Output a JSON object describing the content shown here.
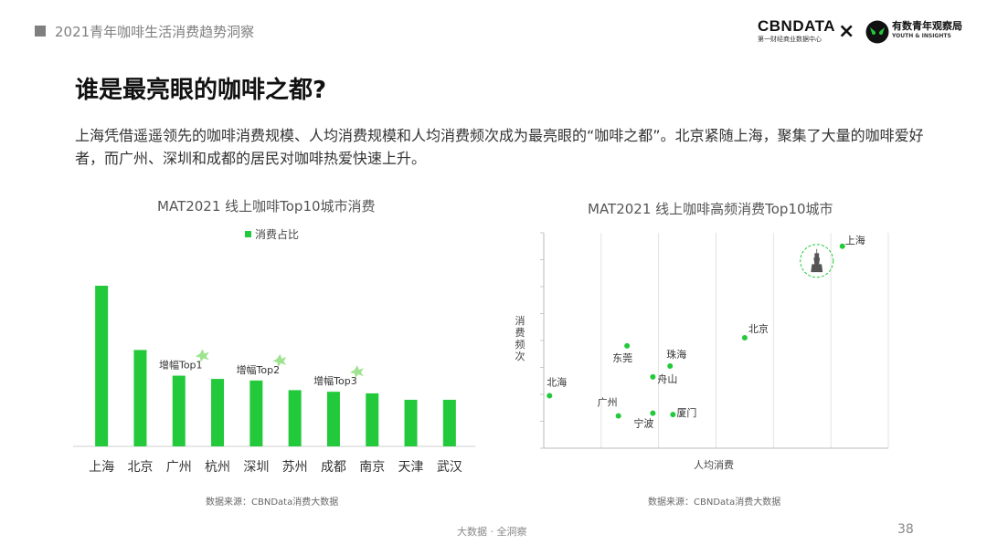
{
  "header": {
    "title": "2021青年咖啡生活消费趋势洞察"
  },
  "logos": {
    "cbn_name": "CBNDATA",
    "cbn_sub": "第一财经商业数据中心",
    "times": "×",
    "youth_name": "有数青年观察局",
    "youth_sub": "YOUTH & INSIGHTS"
  },
  "page": {
    "title": "谁是最亮眼的咖啡之都?",
    "intro": "上海凭借遥遥领先的咖啡消费规模、人均消费规模和人均消费频次成为最亮眼的“咖啡之都”。北京紧随上海，聚集了大量的咖啡爱好者，而广州、深圳和成都的居民对咖啡热爱快速上升。"
  },
  "chart_data": [
    {
      "type": "bar",
      "title": "MAT2021 线上咖啡Top10城市消费",
      "legend": "消费占比",
      "legend_position": "top-center",
      "categories": [
        "上海",
        "北京",
        "广州",
        "杭州",
        "深圳",
        "苏州",
        "成都",
        "南京",
        "天津",
        "武汉"
      ],
      "values": [
        100,
        60,
        44,
        42,
        41,
        35,
        34,
        33,
        29,
        29
      ],
      "ylim": [
        0,
        100
      ],
      "annotations": [
        {
          "category": "广州",
          "text": "增幅Top1"
        },
        {
          "category": "深圳",
          "text": "增幅Top2"
        },
        {
          "category": "成都",
          "text": "增幅Top3"
        }
      ],
      "color": "#22c93a",
      "source": "数据来源：CBNData消费大数据"
    },
    {
      "type": "scatter",
      "title": "MAT2021 线上咖啡高频消费Top10城市",
      "xlabel": "人均消费",
      "ylabel": "消费频次",
      "xlim": [
        0,
        6
      ],
      "ylim": [
        0,
        8
      ],
      "grid": true,
      "points": [
        {
          "label": "上海",
          "x": 5.2,
          "y": 7.5
        },
        {
          "label": "北京",
          "x": 3.5,
          "y": 4.1
        },
        {
          "label": "东莞",
          "x": 1.45,
          "y": 3.8
        },
        {
          "label": "珠海",
          "x": 2.2,
          "y": 3.05
        },
        {
          "label": "舟山",
          "x": 1.9,
          "y": 2.65
        },
        {
          "label": "北海",
          "x": 0.1,
          "y": 1.95
        },
        {
          "label": "广州",
          "x": 1.3,
          "y": 1.2
        },
        {
          "label": "宁波",
          "x": 1.9,
          "y": 1.3
        },
        {
          "label": "厦门",
          "x": 2.25,
          "y": 1.25
        }
      ],
      "color": "#22c93a",
      "source": "数据来源：CBNData消费大数据"
    }
  ],
  "footer": {
    "text": "大数据 · 全洞察",
    "page": "38"
  }
}
